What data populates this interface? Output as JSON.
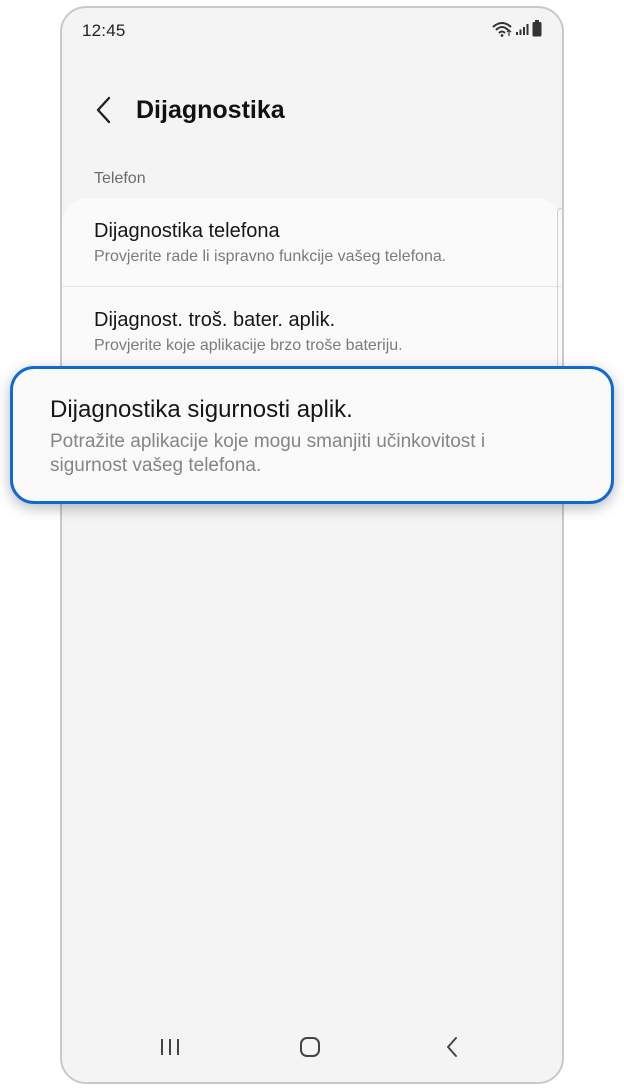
{
  "status_bar": {
    "time": "12:45",
    "icons": [
      "wifi-icon",
      "signal-icon",
      "battery-icon"
    ]
  },
  "header": {
    "back_icon": "chevron-left-icon",
    "title": "Dijagnostika"
  },
  "section": {
    "label": "Telefon"
  },
  "items": [
    {
      "title": "Dijagnostika telefona",
      "subtitle": "Provjerite rade li ispravno funkcije vašeg telefona."
    },
    {
      "title": "Dijagnost. troš. bater. aplik.",
      "subtitle": "Provjerite koje aplikacije brzo troše bateriju."
    }
  ],
  "highlighted_item": {
    "title": "Dijagnostika sigurnosti aplik.",
    "subtitle_line1": "Potražite aplikacije koje mogu smanjiti učinkovitost i",
    "subtitle_line2": "sigurnost vašeg telefona."
  },
  "nav_bar": {
    "buttons": [
      "recents-icon",
      "home-icon",
      "back-icon"
    ]
  },
  "colors": {
    "highlight_border": "#1169d6",
    "background": "#f4f4f4",
    "card": "#fafafa"
  }
}
